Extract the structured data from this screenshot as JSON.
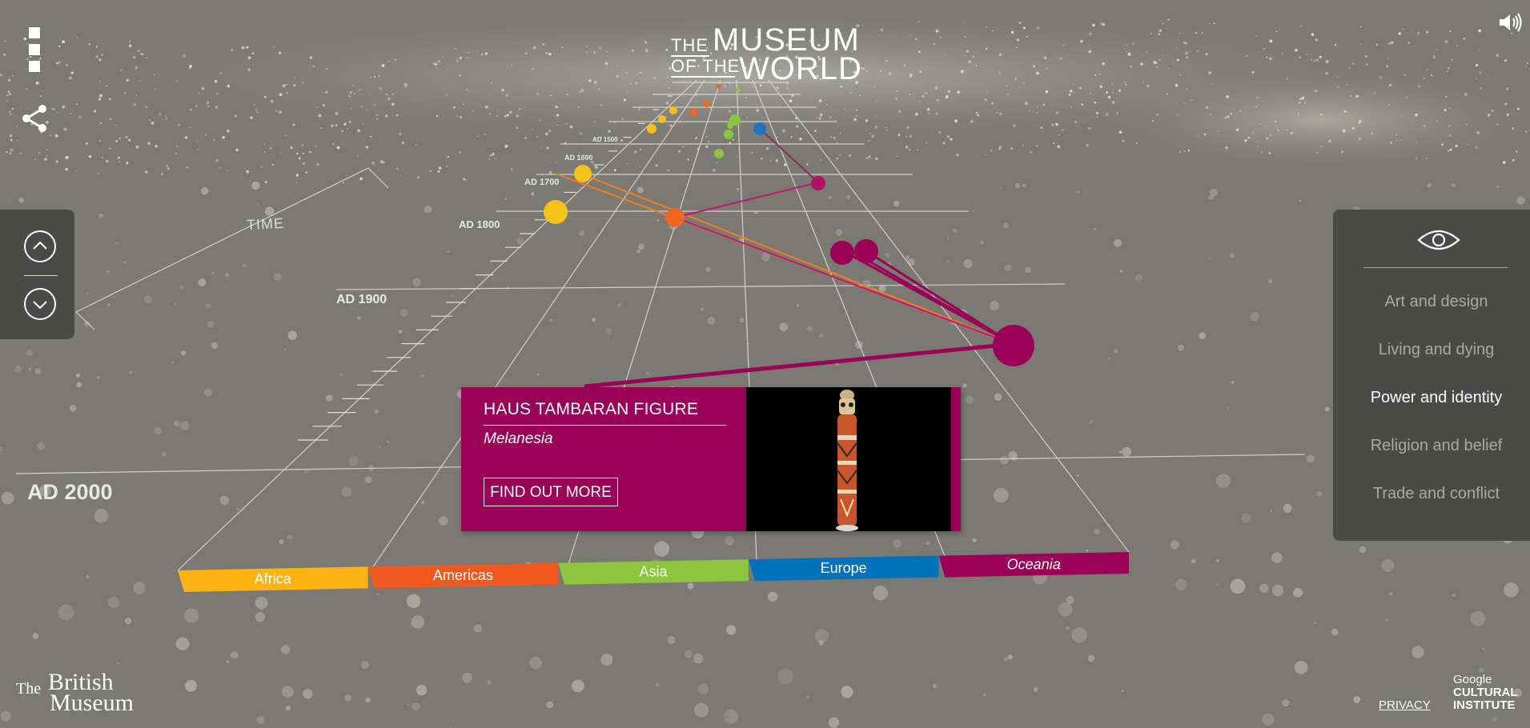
{
  "logo": {
    "the": "THE",
    "museum": "MUSEUM",
    "of_the": "OF THE",
    "world": "WORLD"
  },
  "axis": {
    "time_label": "TIME"
  },
  "dates": [
    "AD 1500",
    "AD 1600",
    "AD 1700",
    "AD 1800",
    "AD 1900",
    "AD 2000"
  ],
  "regions": [
    {
      "label": "Africa",
      "color": "#ffb313"
    },
    {
      "label": "Americas",
      "color": "#f15a1f"
    },
    {
      "label": "Asia",
      "color": "#8cc63f"
    },
    {
      "label": "Europe",
      "color": "#0072bc"
    },
    {
      "label": "Oceania",
      "color": "#9b0058"
    }
  ],
  "filters": {
    "items": [
      {
        "label": "Art and design",
        "active": false
      },
      {
        "label": "Living and dying",
        "active": false
      },
      {
        "label": "Power and identity",
        "active": true
      },
      {
        "label": "Religion and belief",
        "active": false
      },
      {
        "label": "Trade and conflict",
        "active": false
      }
    ]
  },
  "card": {
    "title": "HAUS TAMBARAN FIGURE",
    "subtitle": "Melanesia",
    "button_label": "FIND OUT MORE",
    "color": "#9b0058"
  },
  "footer": {
    "bm_the": "The",
    "bm_british": "British",
    "bm_museum": "Museum",
    "privacy": "PRIVACY",
    "google": "Google",
    "cultural": "CULTURAL",
    "institute": "INSTITUTE"
  },
  "icons": [
    "menu-icon",
    "share-icon",
    "sound-icon",
    "chevron-up-icon",
    "chevron-down-icon",
    "eye-icon"
  ]
}
